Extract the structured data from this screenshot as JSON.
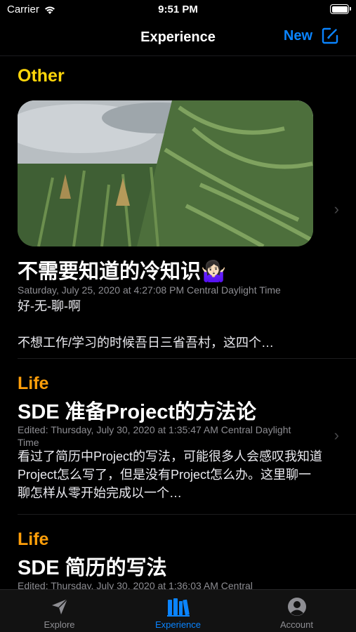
{
  "status_bar": {
    "carrier": "Carrier",
    "time": "9:51 PM"
  },
  "nav": {
    "title": "Experience",
    "new_label": "New"
  },
  "entries": [
    {
      "category": "Other",
      "title": "不需要知道的冷知识🤷🏻‍♀️",
      "meta": "Saturday, July 25, 2020 at 4:27:08 PM Central Daylight Time",
      "body": "好-无-聊-啊\n\n不想工作/学习的时候吾日三省吾村，这四个…"
    },
    {
      "category": "Life",
      "title": "SDE 准备Project的方法论",
      "meta": "Edited: Thursday, July 30, 2020 at 1:35:47 AM Central Daylight Time",
      "body": "看过了简历中Project的写法，可能很多人会感叹我知道Project怎么写了，但是没有Project怎么办。这里聊一聊怎样从零开始完成以一个…"
    },
    {
      "category": "Life",
      "title": "SDE 简历的写法",
      "meta": "Edited: Thursday, July 30, 2020 at 1:36:03 AM Central"
    }
  ],
  "tabs": [
    {
      "label": "Explore",
      "icon": "paper-plane-icon"
    },
    {
      "label": "Experience",
      "icon": "books-icon"
    },
    {
      "label": "Account",
      "icon": "person-circle-icon"
    }
  ],
  "colors": {
    "accent": "#0a84ff",
    "category_other": "#ffd60a",
    "category_life": "#ff9f0a"
  }
}
